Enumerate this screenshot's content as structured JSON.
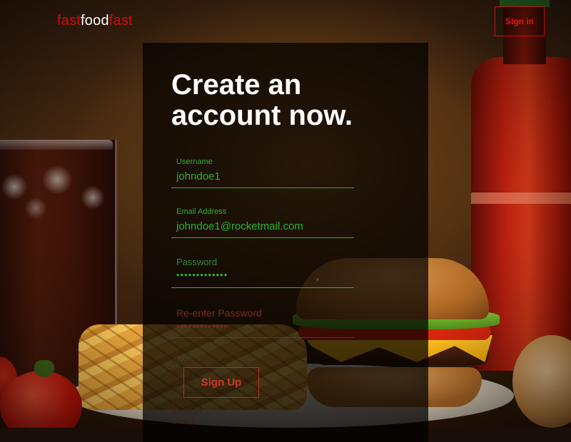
{
  "header": {
    "logo": {
      "part1": "fast",
      "part2": "food",
      "part3": "fast"
    },
    "signin_label": "Sign in"
  },
  "form": {
    "title_line1": "Create an",
    "title_line2": "account now.",
    "fields": [
      {
        "label": "Username",
        "value": "johndoe1"
      },
      {
        "label": "Email Address",
        "value": "johndoe1@rocketmail.com"
      },
      {
        "label": "Password",
        "value": "•••••••••••••"
      },
      {
        "label": "Re-enter Password",
        "value": "•••••••••••••"
      }
    ],
    "error_message": "User already exists. Please use another email",
    "signup_label": "Sign Up"
  },
  "colors": {
    "brand_red": "#cc1010",
    "field_green": "#2fb02f",
    "error_red": "#7a2a1a",
    "panel_bg": "rgba(0,0,0,.72)"
  }
}
